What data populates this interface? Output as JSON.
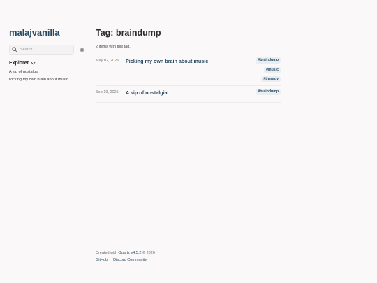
{
  "site": {
    "title": "malajvanilla"
  },
  "search": {
    "placeholder": "Search"
  },
  "explorer": {
    "title": "Explorer",
    "items": [
      {
        "label": "A sip of nostalgia"
      },
      {
        "label": "Picking my own brain about music"
      }
    ]
  },
  "page": {
    "title": "Tag: braindump",
    "count": "2 items with this tag."
  },
  "posts": [
    {
      "date": "May 02, 2026",
      "title": "Picking my own brain about music",
      "tags": [
        "#braindump",
        "#music",
        "#therapy"
      ]
    },
    {
      "date": "Sep 19, 2025",
      "title": "A sip of nostalgia",
      "tags": [
        "#braindump"
      ]
    }
  ],
  "footer": {
    "created_prefix": "Created with",
    "quartz_link": "Quartz v4.5.2",
    "created_suffix": "© 2026",
    "links": [
      "GitHub",
      "Discord Community"
    ]
  },
  "colors": {
    "accent": "#284b63",
    "background": "#faf8f8",
    "tag_bg": "#e9eef1"
  },
  "icons": [
    "search-icon",
    "sun-icon",
    "chevron-down-icon"
  ]
}
